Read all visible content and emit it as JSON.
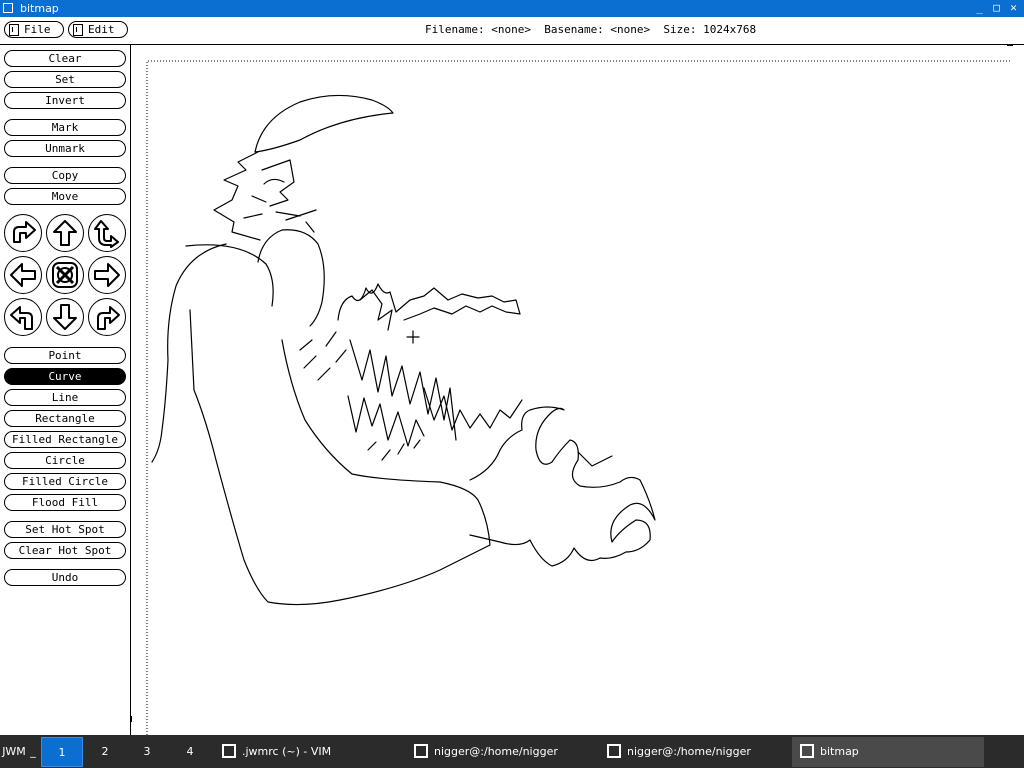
{
  "window": {
    "title": "bitmap",
    "buttons": {
      "minimize": "_",
      "maximize": "□",
      "close": "✕"
    }
  },
  "menus": {
    "file": "File",
    "edit": "Edit"
  },
  "info": {
    "text": "Filename: <none>  Basename: <none>  Size: 1024x768"
  },
  "commands": [
    "Clear",
    "Set",
    "Invert",
    "Mark",
    "Unmark",
    "Copy",
    "Move"
  ],
  "arrows": [
    "flip-horizontally",
    "up",
    "flip-vertically",
    "left",
    "fold",
    "right",
    "rotate-left",
    "down",
    "rotate-right"
  ],
  "tools": [
    "Point",
    "Curve",
    "Line",
    "Rectangle",
    "Filled Rectangle",
    "Circle",
    "Filled Circle",
    "Flood Fill"
  ],
  "active_tool": "Curve",
  "hotspot": [
    "Set Hot Spot",
    "Clear Hot Spot"
  ],
  "undo": "Undo",
  "taskbar": {
    "menu_label": "JWM",
    "dash": "_",
    "desktops": [
      "1",
      "2",
      "3",
      "4"
    ],
    "active_desktop": "1",
    "tasks": [
      ".jwmrc (~) - VIM",
      "nigger@:/home/nigger",
      "nigger@:/home/nigger",
      "bitmap"
    ],
    "active_task": "bitmap",
    "colors": {
      "bar": "#2b2b2b",
      "active_desktop": "#0a6fd1",
      "active_task": "#4a4a4a"
    }
  }
}
